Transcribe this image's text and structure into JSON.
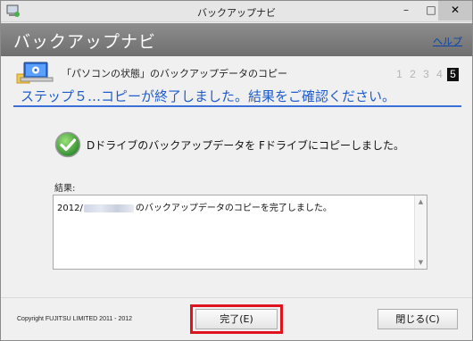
{
  "window": {
    "title": "バックアップナビ",
    "minimize_glyph": "–",
    "maximize_glyph": "□",
    "close_glyph": "✕"
  },
  "header": {
    "title": "バックアップナビ",
    "help_link": "ヘルプ"
  },
  "step": {
    "icon": "laptop-settings-icon",
    "description": "「パソコンの状態」のバックアップデータのコピー",
    "numbers": [
      "1",
      "2",
      "3",
      "4",
      "5"
    ],
    "current": "5",
    "heading": "ステップ５…コピーが終了しました。結果をご確認ください。"
  },
  "result": {
    "check_icon": "success-check-icon",
    "message": "Dドライブのバックアップデータを Fドライブにコピーしました。",
    "label": "結果:",
    "text_prefix": "2012/",
    "text_suffix": "のバックアップデータのコピーを完了しました。"
  },
  "footer": {
    "copyright": "Copyright FUJITSU LIMITED 2011 - 2012",
    "finish_label": "完了(E)",
    "close_label": "閉じる(C)"
  },
  "colors": {
    "header_bg": "#7f7f7f",
    "heading_blue": "#1f5ccc",
    "highlight_red": "#e0141e",
    "check_green": "#3aa63a"
  }
}
